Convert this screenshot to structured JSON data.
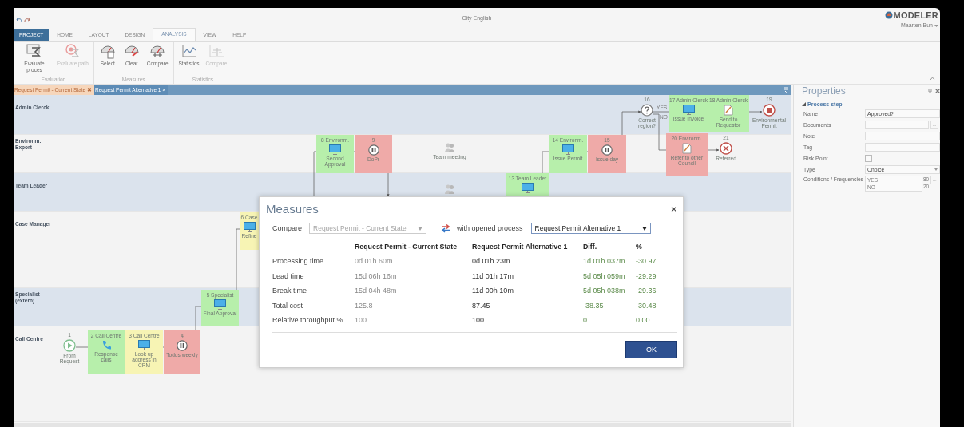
{
  "window": {
    "title": "City English",
    "logo": "MODELER",
    "user": "Maarten Bun"
  },
  "ribbon_tabs": [
    {
      "label": "PROJECT",
      "kind": "file",
      "selected": false
    },
    {
      "label": "HOME",
      "kind": "tab",
      "selected": false
    },
    {
      "label": "LAYOUT",
      "kind": "tab",
      "selected": false
    },
    {
      "label": "DESIGN",
      "kind": "tab",
      "selected": false
    },
    {
      "label": "ANALYSIS",
      "kind": "tab",
      "selected": true
    },
    {
      "label": "VIEW",
      "kind": "tab",
      "selected": false
    },
    {
      "label": "HELP",
      "kind": "tab",
      "selected": false
    }
  ],
  "ribbon_groups": [
    {
      "name": "Evaluation",
      "buttons": [
        {
          "label": "Evaluate proces",
          "kind": "evaluate",
          "disabled": false
        },
        {
          "label": "Evaluate path",
          "kind": "evaluate-path",
          "disabled": true
        }
      ]
    },
    {
      "name": "Measures",
      "buttons": [
        {
          "label": "Select",
          "kind": "select",
          "disabled": false
        },
        {
          "label": "Clear",
          "kind": "clear",
          "disabled": false
        },
        {
          "label": "Compare",
          "kind": "compare",
          "disabled": false
        }
      ]
    },
    {
      "name": "Statistics",
      "buttons": [
        {
          "label": "Statistics",
          "kind": "statistics",
          "disabled": false
        },
        {
          "label": "Compare",
          "kind": "compare-stats",
          "disabled": true
        }
      ]
    }
  ],
  "documents": [
    {
      "label": "Request Permit - Current State",
      "close": "✖",
      "selected": false
    },
    {
      "label": "Request Permit Alternative 1",
      "close": "×",
      "selected": true
    }
  ],
  "lanes": [
    {
      "lines": [
        "Admin Clerck"
      ]
    },
    {
      "lines": [
        "Environm.",
        "Export"
      ]
    },
    {
      "lines": [
        "Team Leader"
      ]
    },
    {
      "lines": [
        "Case Manager"
      ]
    },
    {
      "lines": [
        "Specialist",
        "(extern)"
      ]
    },
    {
      "lines": [
        "Call Centre"
      ]
    }
  ],
  "nodes": [
    {
      "kind": "start",
      "number": "1",
      "label": "From Request"
    },
    {
      "kind": "phone-task",
      "title": "2 Call Centre",
      "label": "Response calls",
      "color": "#b7efab"
    },
    {
      "kind": "system-task",
      "title": "3 Call Centre",
      "label": "Look up address in CRM",
      "color": "#f7f4b4"
    },
    {
      "kind": "wait",
      "title": "4",
      "label": "Todos weekly",
      "color": "#efaaa8"
    },
    {
      "kind": "system-task",
      "title": "5 Specialist",
      "label": "Final Approval",
      "color": "#b7efab"
    },
    {
      "kind": "system-task",
      "title": "6 Case",
      "label": "Refine",
      "color": "#f7f4b4"
    },
    {
      "kind": "system-task",
      "title": "8 Environm.",
      "label": "Second Approval",
      "color": "#b7efab"
    },
    {
      "kind": "wait",
      "title": "9",
      "label": "DoPr",
      "color": "#efaaa8"
    },
    {
      "kind": "meeting",
      "label": "Team meeting"
    },
    {
      "kind": "meeting"
    },
    {
      "kind": "system-task",
      "title": "13 Team Leader",
      "color": "#b7efab"
    },
    {
      "kind": "system-task",
      "title": "14 Environm.",
      "label": "Issue Permit",
      "color": "#b7efab"
    },
    {
      "kind": "wait",
      "title": "15",
      "label": "Issue day",
      "color": "#efaaa8"
    },
    {
      "kind": "decision",
      "number": "16",
      "label": "Correct region?"
    },
    {
      "kind": "system-task",
      "title": "17 Admin Clerck",
      "label": "Issue Invoice",
      "color": "#b7efab"
    },
    {
      "kind": "document-task",
      "title": "18 Admin Clerck",
      "label": "Send to Requestor",
      "color": "#b7efab"
    },
    {
      "kind": "end",
      "number": "19",
      "label": "Environmental Permit"
    },
    {
      "kind": "document-task",
      "title": "20 Environm.",
      "label": "Refer to other Council",
      "color": "#efaaa8"
    },
    {
      "kind": "cancel",
      "number": "21",
      "label": "Referred"
    }
  ],
  "edge_labels": [
    "YES",
    "NO"
  ],
  "dialog": {
    "title": "Measures",
    "close": "×",
    "compare_label": "Compare",
    "base_process": {
      "value": "Request Permit - Current State",
      "disabled": true
    },
    "with_label": "with opened process",
    "opened_process": {
      "value": "Request Permit Alternative 1",
      "disabled": false
    },
    "columns": [
      "Request Permit - Current State",
      "Request Permit Alternative 1",
      "Diff.",
      "%"
    ],
    "rows": [
      {
        "name": "Processing time",
        "current": "0d 01h 60m",
        "alternative": "0d 01h 23m",
        "diff": "1d 01h 037m",
        "percent": "-30.97"
      },
      {
        "name": "Lead time",
        "current": "15d 06h 16m",
        "alternative": "11d 01h 17m",
        "diff": "5d 05h 059m",
        "percent": "-29.29"
      },
      {
        "name": "Break time",
        "current": "15d 04h 48m",
        "alternative": "11d 00h 10m",
        "diff": "5d 05h 038m",
        "percent": "-29.36"
      },
      {
        "name": "Total cost",
        "current": "125.8",
        "alternative": "87.45",
        "diff": "-38.35",
        "percent": "-30.48"
      },
      {
        "name": "Relative throughput %",
        "current": "100",
        "alternative": "100",
        "diff": "0",
        "percent": "0.00"
      }
    ],
    "ok": "OK"
  },
  "properties": {
    "title": "Properties",
    "section": "Process step",
    "expanded": true,
    "fields": [
      {
        "label": "Name",
        "kind": "text",
        "value": "Approved?"
      },
      {
        "label": "Documents",
        "kind": "browse",
        "button": "..."
      },
      {
        "label": "Note",
        "kind": "text"
      },
      {
        "label": "Tag",
        "kind": "text"
      },
      {
        "label": "Risk Point",
        "kind": "checkbox",
        "checked": false
      },
      {
        "label": "Type",
        "kind": "select",
        "value": "Choice"
      },
      {
        "label": "Conditions / Frequencies",
        "kind": "conditions",
        "button": "...",
        "conditions": [
          {
            "name": "YES",
            "frequency": "80"
          },
          {
            "name": "NO",
            "frequency": "20"
          }
        ]
      }
    ]
  }
}
